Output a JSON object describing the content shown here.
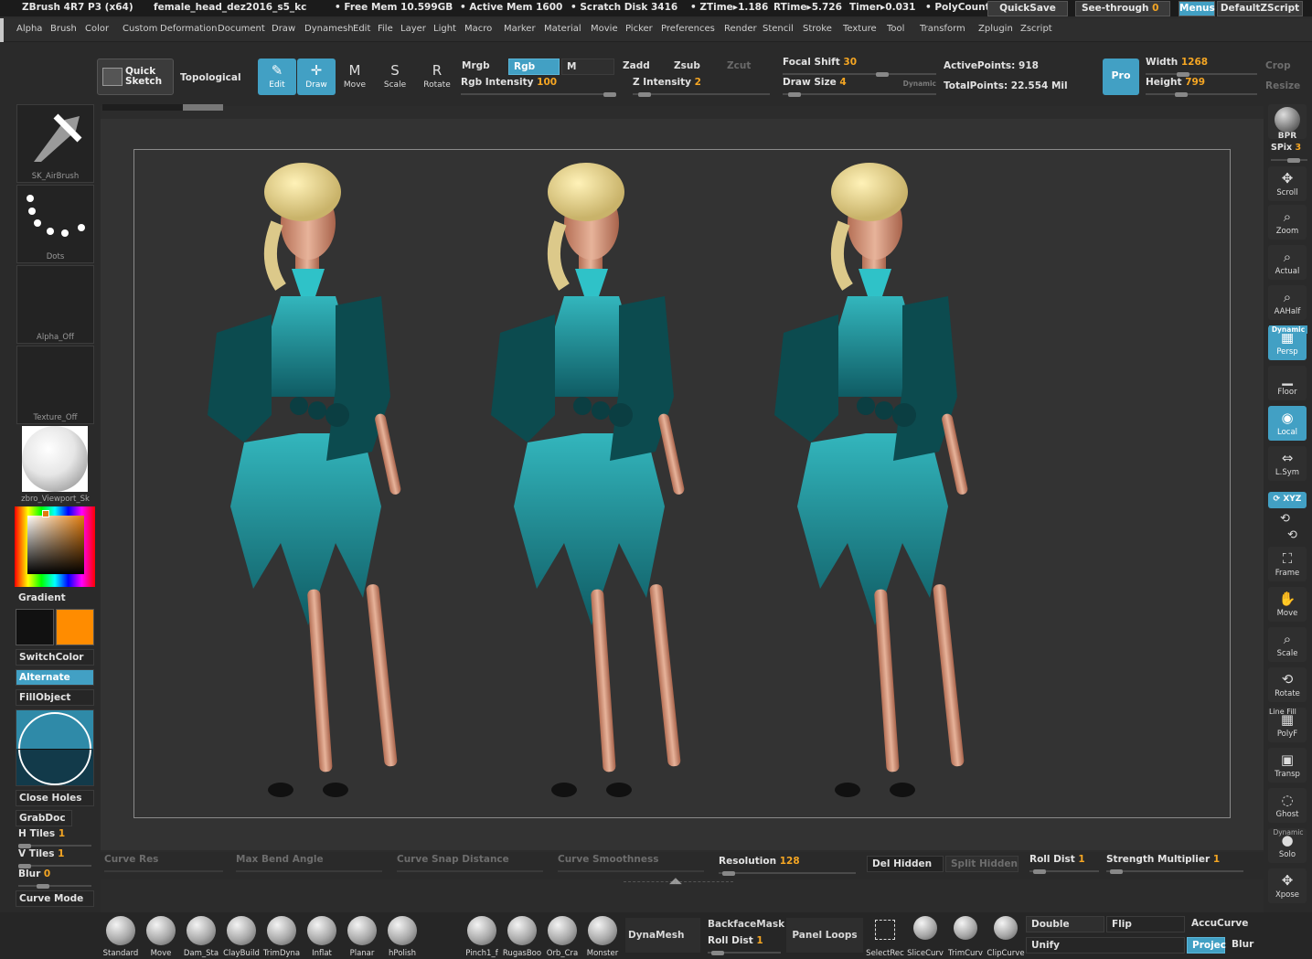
{
  "titlebar": {
    "app": "ZBrush 4R7 P3 (x64)",
    "file": "female_head_dez2016_s5_kc",
    "free_mem": "• Free Mem 10.599GB",
    "active_mem": "• Active Mem 1600",
    "scratch": "• Scratch Disk 3416",
    "ztime": "• ZTime▸1.186",
    "rtime": "RTime▸5.726",
    "timer": "Timer▸0.031",
    "polycount": "• PolyCount",
    "quicksave": "QuickSave",
    "seethrough": "See-through",
    "seethrough_val": "0",
    "menus": "Menus",
    "script": "DefaultZScript"
  },
  "menubar": [
    "Alpha",
    "Brush",
    "Color",
    "Custom",
    "Deformation",
    "Document",
    "Draw",
    "Dynamesh",
    "Edit",
    "File",
    "Layer",
    "Light",
    "Macro",
    "Marker",
    "Material",
    "Movie",
    "Picker",
    "Preferences",
    "Render",
    "Stencil",
    "Stroke",
    "Texture",
    "Tool",
    "Transform",
    "Zplugin",
    "Zscript"
  ],
  "toolbar": {
    "quick_sketch": "Quick Sketch",
    "topological": "Topological",
    "tools": [
      {
        "label": "Edit",
        "on": true,
        "icon": "✎"
      },
      {
        "label": "Draw",
        "on": true,
        "icon": "✛"
      },
      {
        "label": "Move",
        "on": false,
        "icon": "M"
      },
      {
        "label": "Scale",
        "on": false,
        "icon": "S"
      },
      {
        "label": "Rotate",
        "on": false,
        "icon": "R"
      }
    ],
    "mrgb": "Mrgb",
    "rgb": "Rgb",
    "m": "M",
    "zadd": "Zadd",
    "zsub": "Zsub",
    "zcut": "Zcut",
    "rgb_intensity": "Rgb Intensity",
    "rgb_intensity_val": "100",
    "z_intensity": "Z Intensity",
    "z_intensity_val": "2",
    "focal_shift": "Focal Shift",
    "focal_shift_val": "30",
    "draw_size": "Draw Size",
    "draw_size_val": "4",
    "dynamic": "Dynamic",
    "active_points": "ActivePoints: 918",
    "total_points": "TotalPoints: 22.554 Mil",
    "pro": "Pro",
    "width": "Width",
    "width_val": "1268",
    "height": "Height",
    "height_val": "799",
    "crop": "Crop",
    "resize": "Resize"
  },
  "left": {
    "brush": "SK_AirBrush",
    "stroke": "Dots",
    "alpha": "Alpha_Off",
    "texture": "Texture_Off",
    "material": "zbro_Viewport_Sk",
    "gradient": "Gradient",
    "switchcolor": "SwitchColor",
    "alternate": "Alternate",
    "fillobject": "FillObject",
    "close_holes": "Close Holes",
    "grabdoc": "GrabDoc",
    "h_tiles": "H Tiles",
    "h_tiles_val": "1",
    "v_tiles": "V Tiles",
    "v_tiles_val": "1",
    "blur": "Blur",
    "blur_val": "0",
    "curve_mode": "Curve Mode",
    "main_color": "#111111",
    "secondary_color": "#ff8c00"
  },
  "right": {
    "bpr": "BPR",
    "spix": "SPix",
    "spix_val": "3",
    "buttons": [
      {
        "label": "Scroll",
        "icon": "✥",
        "on": false
      },
      {
        "label": "Zoom",
        "icon": "⌕",
        "on": false
      },
      {
        "label": "Actual",
        "icon": "⌕",
        "on": false
      },
      {
        "label": "AAHalf",
        "icon": "⌕",
        "on": false
      },
      {
        "label": "Persp",
        "icon": "▦",
        "on": true
      },
      {
        "label": "Floor",
        "icon": "▁",
        "on": false
      },
      {
        "label": "Local",
        "icon": "◉",
        "on": true
      },
      {
        "label": "L.Sym",
        "icon": "⇔",
        "on": false
      }
    ],
    "xyz": "XYZ",
    "buttons2": [
      {
        "label": "Frame",
        "icon": "⛶",
        "on": false
      },
      {
        "label": "Move",
        "icon": "✋",
        "on": false
      },
      {
        "label": "Scale",
        "icon": "⌕",
        "on": false
      },
      {
        "label": "Rotate",
        "icon": "⟲",
        "on": false
      },
      {
        "label": "PolyF",
        "icon": "▦",
        "on": false
      },
      {
        "label": "Transp",
        "icon": "▣",
        "on": false
      },
      {
        "label": "Ghost",
        "icon": "◌",
        "on": false
      },
      {
        "label": "Solo",
        "icon": "●",
        "on": false
      },
      {
        "label": "Xpose",
        "icon": "✥",
        "on": false
      }
    ],
    "dynamic_lbl": "Dynamic",
    "linefill": "Line Fill"
  },
  "bottom": {
    "curve_res": "Curve Res",
    "max_bend": "Max Bend Angle",
    "curve_snap": "Curve Snap Distance",
    "curve_smooth": "Curve Smoothness",
    "resolution": "Resolution",
    "resolution_val": "128",
    "del_hidden": "Del Hidden",
    "split_hidden": "Split Hidden",
    "roll_dist": "Roll Dist",
    "roll_dist_val": "1",
    "strength_mult": "Strength Multiplier",
    "strength_mult_val": "1"
  },
  "brushes": [
    "Standard",
    "Move",
    "Dam_Sta",
    "ClayBuild",
    "TrimDyna",
    "Inflat",
    "Planar",
    "hPolish"
  ],
  "brushes2": [
    "Pinch1_f",
    "RugasBoo",
    "Orb_Cra",
    "Monster"
  ],
  "shelf": {
    "dynamesh": "DynaMesh",
    "backfacemask": "BackfaceMask",
    "roll_dist": "Roll Dist",
    "roll_dist_val": "1",
    "panel_loops": "Panel Loops",
    "selectrec": "SelectRec",
    "slicecurve": "SliceCurv",
    "trimcurve": "TrimCurv",
    "clipcurve": "ClipCurve",
    "double": "Double",
    "flip": "Flip",
    "accucurve": "AccuCurve",
    "unify": "Unify",
    "project": "Projec",
    "blur": "Blur"
  }
}
